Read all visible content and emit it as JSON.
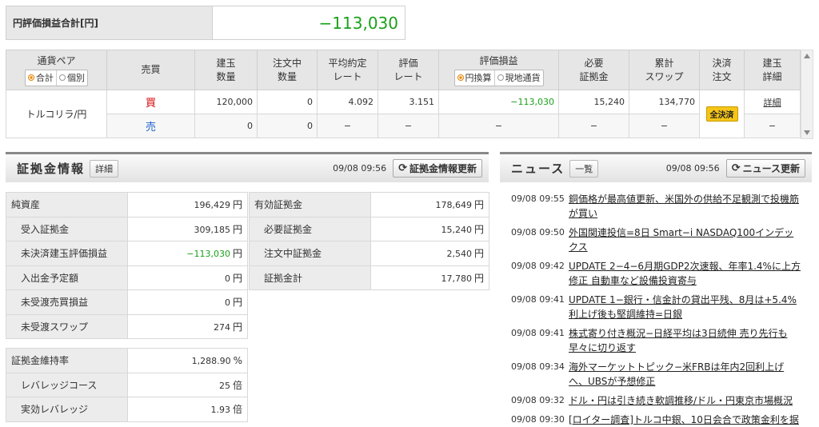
{
  "summary": {
    "label": "円評価損益合計[円]",
    "value": "−113,030"
  },
  "positions": {
    "headers": {
      "pair": "通貨ペア",
      "pair_radio": [
        "合計",
        "個別"
      ],
      "side": "売買",
      "qty": [
        "建玉",
        "数量"
      ],
      "order_qty": [
        "注文中",
        "数量"
      ],
      "avg_rate": [
        "平均約定",
        "レート"
      ],
      "eval_rate": [
        "評価",
        "レート"
      ],
      "pnl": "評価損益",
      "pnl_radio": [
        "円換算",
        "現地通貨"
      ],
      "margin": [
        "必要",
        "証拠金"
      ],
      "swap": [
        "累計",
        "スワップ"
      ],
      "settle": [
        "決済",
        "注文"
      ],
      "detail": [
        "建玉",
        "詳細"
      ]
    },
    "pair_name": "トルコリラ/円",
    "buy": {
      "side": "買",
      "qty": "120,000",
      "order_qty": "0",
      "avg_rate": "4.092",
      "eval_rate": "3.151",
      "pnl": "−113,030",
      "margin": "15,240",
      "swap": "134,770",
      "detail": "詳細"
    },
    "sell": {
      "side": "売",
      "qty": "0",
      "order_qty": "0",
      "avg_rate": "−",
      "eval_rate": "−",
      "pnl": "−",
      "margin": "−",
      "swap": "−",
      "detail": "−"
    },
    "settle_button": "全決済"
  },
  "margin_panel": {
    "title": "証拠金情報",
    "detail_button": "詳細",
    "timestamp": "09/08 09:56",
    "refresh_button": "証拠金情報更新",
    "left_rows": [
      {
        "label": "純資産",
        "value": "196,429",
        "unit": "円"
      },
      {
        "label": "受入証拠金",
        "value": "309,185",
        "unit": "円"
      },
      {
        "label": "未決済建玉評価損益",
        "value": "−113,030",
        "unit": "円"
      },
      {
        "label": "入出金予定額",
        "value": "0",
        "unit": "円"
      },
      {
        "label": "未受渡売買損益",
        "value": "0",
        "unit": "円"
      },
      {
        "label": "未受渡スワップ",
        "value": "274",
        "unit": "円"
      }
    ],
    "right_rows": [
      {
        "label": "有効証拠金",
        "value": "178,649",
        "unit": "円"
      },
      {
        "label": "必要証拠金",
        "value": "15,240",
        "unit": "円"
      },
      {
        "label": "注文中証拠金",
        "value": "2,540",
        "unit": "円"
      },
      {
        "label": "証拠金計",
        "value": "17,780",
        "unit": "円"
      }
    ],
    "lev_rows": [
      {
        "label": "証拠金維持率",
        "value": "1,288.90",
        "unit": "%"
      },
      {
        "label": "レバレッジコース",
        "value": "25",
        "unit": "倍"
      },
      {
        "label": "実効レバレッジ",
        "value": "1.93",
        "unit": "倍"
      }
    ]
  },
  "news_panel": {
    "title": "ニュース",
    "list_button": "一覧",
    "timestamp": "09/08 09:56",
    "refresh_button": "ニュース更新",
    "items": [
      {
        "time": "09/08 09:55",
        "headline": "銅価格が最高値更新、米国外の供給不足観測で投機筋が買い"
      },
      {
        "time": "09/08 09:50",
        "headline": "外国関連投信=8日 Smart−i NASDAQ100インデックス"
      },
      {
        "time": "09/08 09:42",
        "headline": "UPDATE 2−4−6月期GDP2次速報、年率1.4%に上方修正 自動車など設備投資寄与"
      },
      {
        "time": "09/08 09:41",
        "headline": "UPDATE 1−銀行・信金計の貸出平残、8月は+5.4% 利上げ後も堅調維持=日銀"
      },
      {
        "time": "09/08 09:41",
        "headline": "株式寄り付き概況−日経平均は3日続伸 売り先行も早々に切り返す"
      },
      {
        "time": "09/08 09:34",
        "headline": "海外マーケットトピック−米FRBは年内2回利上げへ、UBSが予想修正"
      },
      {
        "time": "09/08 09:32",
        "headline": "ドル・円は引き続き軟調推移/ドル・円東京市場概況"
      },
      {
        "time": "09/08 09:30",
        "headline": "[ロイター調査]トルコ中銀、10日会合で政策金利を据"
      }
    ]
  }
}
